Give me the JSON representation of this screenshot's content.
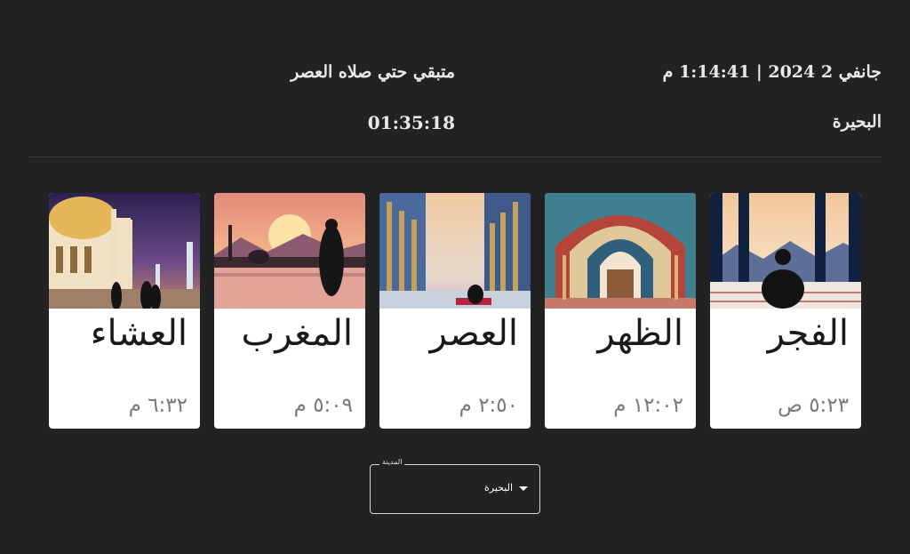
{
  "header": {
    "date_time": "جانفي 2 2024 | 1:14:41 م",
    "remaining_label": "متبقي حتي صلاه العصر",
    "city": "البحيرة",
    "countdown": "01:35:18"
  },
  "prayers": [
    {
      "name": "الفجر",
      "time": "٥:٢٣ ص",
      "icon": "fajr-praying-silhouette-image"
    },
    {
      "name": "الظهر",
      "time": "١٢:٠٢ م",
      "icon": "dhuhr-mosque-arch-image"
    },
    {
      "name": "العصر",
      "time": "٢:٥٠ م",
      "icon": "asr-mosque-colonnade-image"
    },
    {
      "name": "المغرب",
      "time": "٥:٠٩ م",
      "icon": "maghrib-sunset-silhouette-image"
    },
    {
      "name": "العشاء",
      "time": "٦:٣٢ م",
      "icon": "isha-night-mosque-image"
    }
  ],
  "city_select": {
    "label": "المدينة",
    "value": "البحيرة"
  }
}
